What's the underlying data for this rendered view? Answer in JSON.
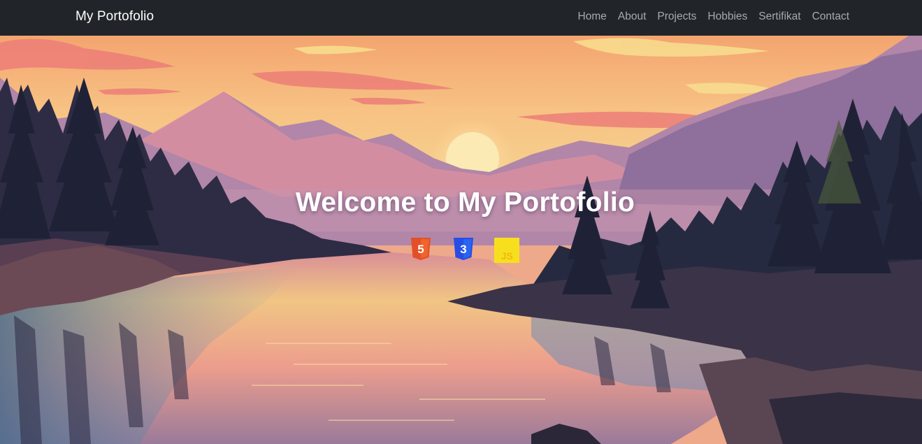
{
  "navbar": {
    "brand": "My Portofolio",
    "links": [
      "Home",
      "About",
      "Projects",
      "Hobbies",
      "Sertifikat",
      "Contact"
    ]
  },
  "hero": {
    "title": "Welcome to My Portofolio",
    "icons": [
      {
        "name": "html5-icon",
        "glyph": "5",
        "color": "#e34f26"
      },
      {
        "name": "css3-icon",
        "glyph": "3",
        "color": "#264de4"
      },
      {
        "name": "javascript-icon",
        "glyph": "JS",
        "color": "#f7df1e"
      }
    ]
  },
  "colors": {
    "navbar_bg": "#212529",
    "brand_text": "#ffffff",
    "nav_text": "#a6a8ab"
  }
}
